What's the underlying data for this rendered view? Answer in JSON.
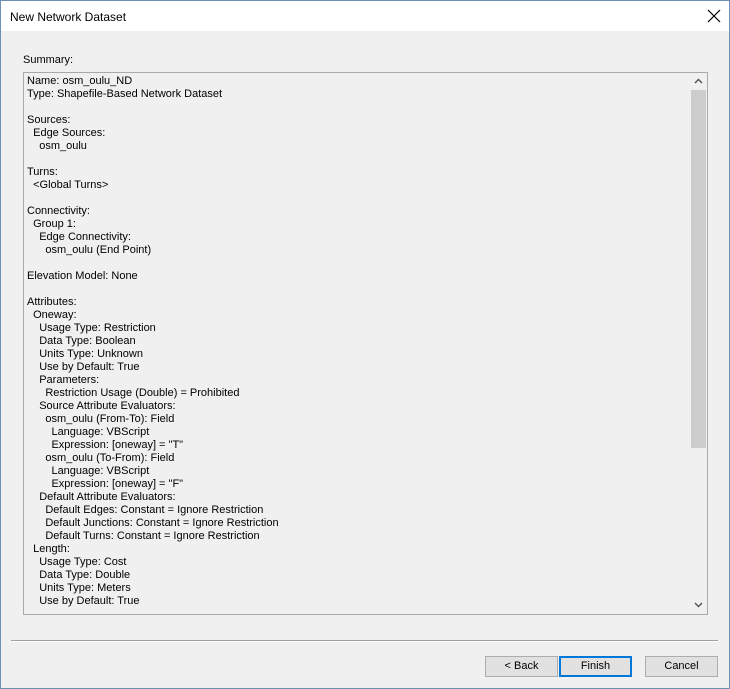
{
  "window": {
    "title": "New Network Dataset"
  },
  "summary": {
    "label": "Summary:",
    "lines": [
      "Name: osm_oulu_ND",
      "Type: Shapefile-Based Network Dataset",
      "",
      "Sources:",
      "  Edge Sources:",
      "    osm_oulu",
      "",
      "Turns:",
      "  <Global Turns>",
      "",
      "Connectivity:",
      "  Group 1:",
      "    Edge Connectivity:",
      "      osm_oulu (End Point)",
      "",
      "Elevation Model: None",
      "",
      "Attributes:",
      "  Oneway:",
      "    Usage Type: Restriction",
      "    Data Type: Boolean",
      "    Units Type: Unknown",
      "    Use by Default: True",
      "    Parameters:",
      "      Restriction Usage (Double) = Prohibited",
      "    Source Attribute Evaluators:",
      "      osm_oulu (From-To): Field",
      "        Language: VBScript",
      "        Expression: [oneway] = \"T\"",
      "      osm_oulu (To-From): Field",
      "        Language: VBScript",
      "        Expression: [oneway] = \"F\"",
      "    Default Attribute Evaluators:",
      "      Default Edges: Constant = Ignore Restriction",
      "      Default Junctions: Constant = Ignore Restriction",
      "      Default Turns: Constant = Ignore Restriction",
      "  Length:",
      "    Usage Type: Cost",
      "    Data Type: Double",
      "    Units Type: Meters",
      "    Use by Default: True"
    ]
  },
  "buttons": {
    "back": "< Back",
    "finish": "Finish",
    "cancel": "Cancel"
  },
  "icons": {
    "close": "close-icon",
    "scroll_up": "chevron-up-icon",
    "scroll_down": "chevron-down-icon"
  },
  "colors": {
    "window_border": "#6e8fb4",
    "dialog_bg": "#f0f0f0",
    "default_button_border": "#0078d7",
    "scroll_thumb": "#cdcdcd"
  }
}
